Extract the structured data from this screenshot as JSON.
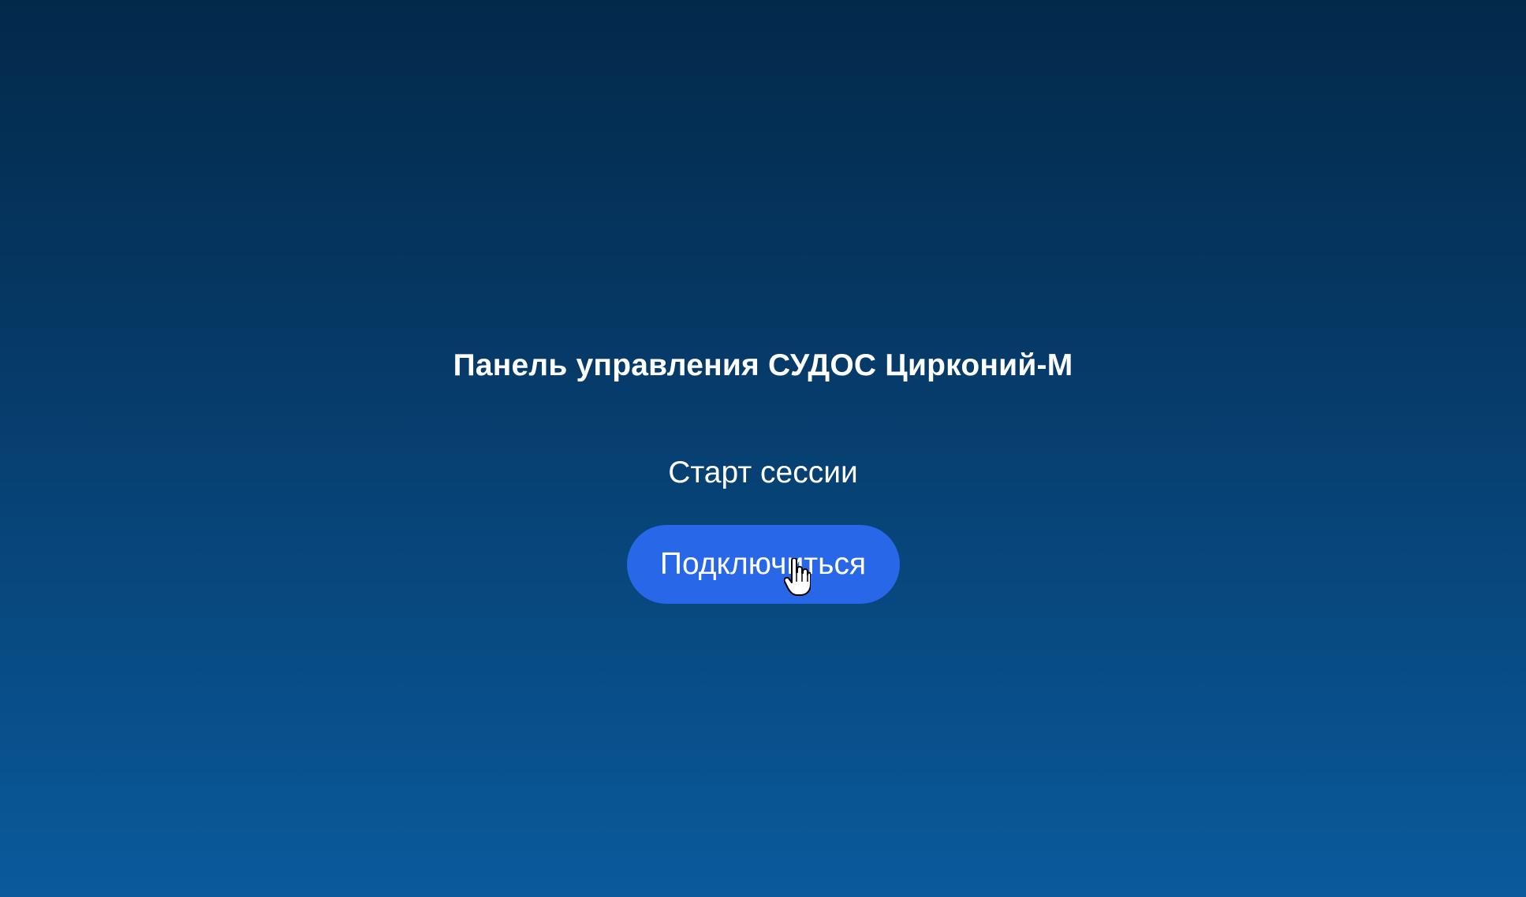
{
  "panel": {
    "title": "Панель управления СУДОС Цирконий-М",
    "subtitle": "Старт сессии",
    "connect_label": "Подключиться"
  },
  "cursor": {
    "icon": "hand-pointer-icon"
  },
  "colors": {
    "background_top": "#03294a",
    "background_bottom": "#0a5a9c",
    "button": "#2767e8",
    "text": "#ffffff"
  }
}
